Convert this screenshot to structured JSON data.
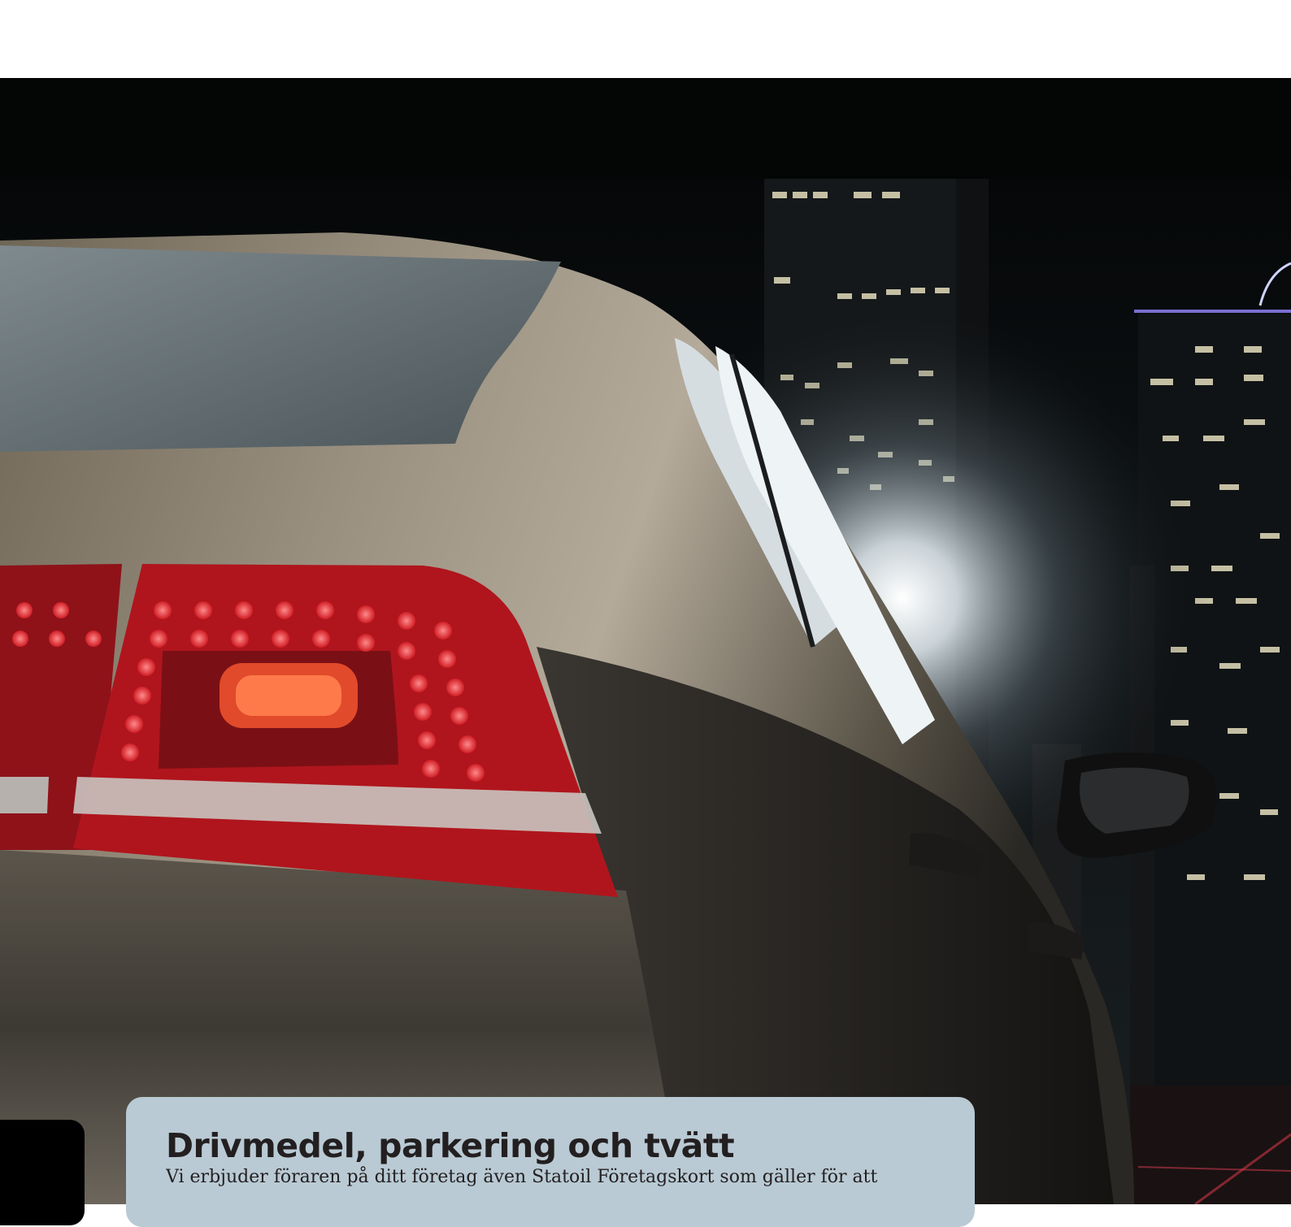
{
  "card": {
    "heading": "Drivmedel, parkering och tvätt",
    "body": "Vi erbjuder föraren på ditt företag även Statoil Företagskort som gäller för att"
  }
}
